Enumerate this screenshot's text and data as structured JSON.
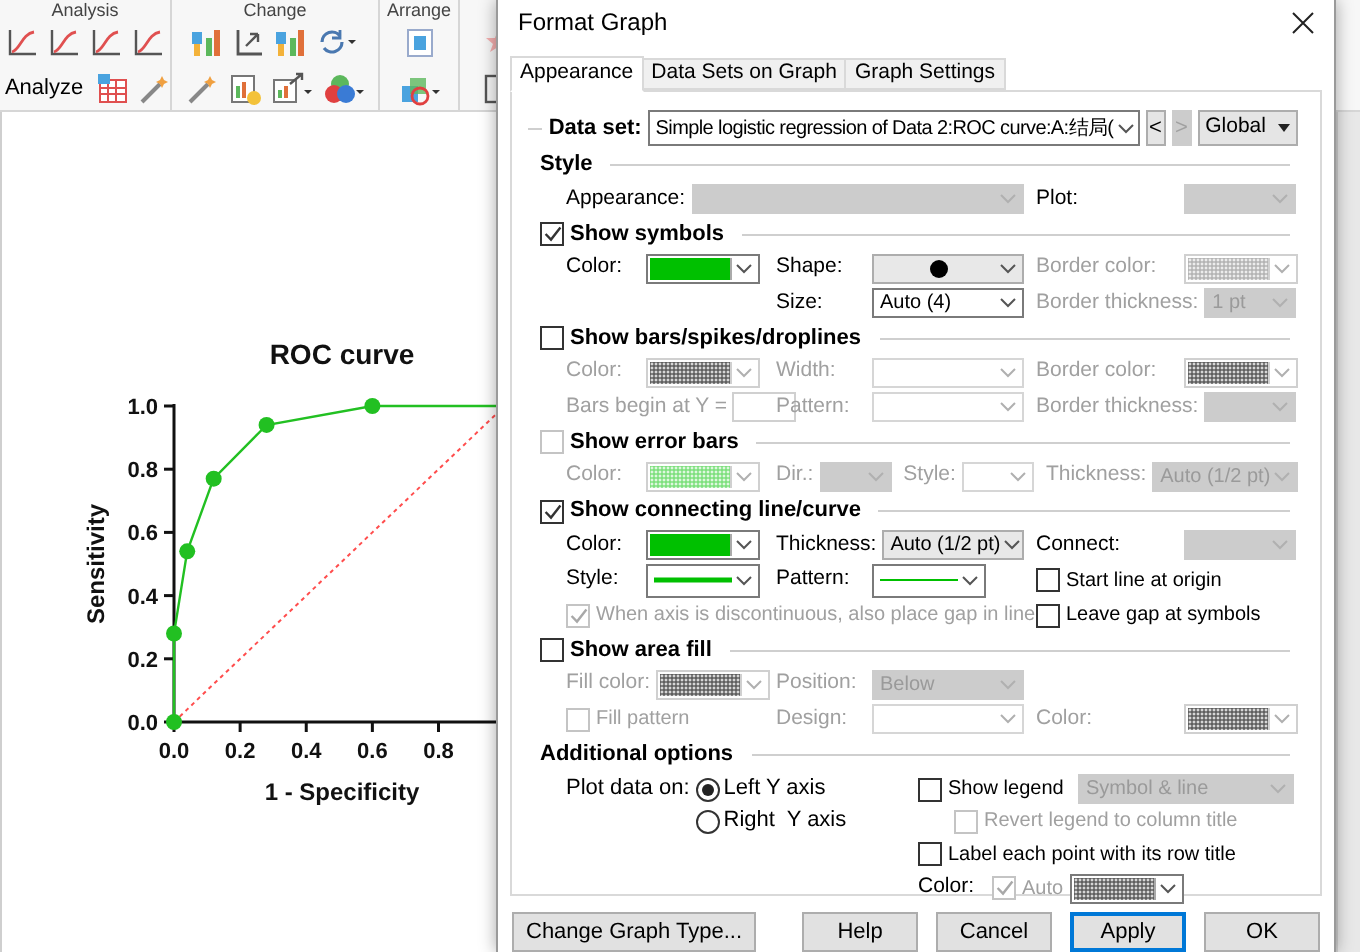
{
  "app": {
    "ribbon_groups": [
      "Analysis",
      "Change",
      "Arrange"
    ],
    "analyze_button": "Analyze"
  },
  "graph": {
    "chart_data": {
      "type": "line",
      "title": "ROC curve",
      "xlabel": "1 - Specificity",
      "ylabel": "Sensitivity",
      "x": [
        0,
        0,
        0.04,
        0.12,
        0.28,
        0.6,
        0.98
      ],
      "series": [
        {
          "color": "#22c022",
          "marker": "circle",
          "line_style": "solid",
          "values": [
            0,
            0.28,
            0.54,
            0.77,
            0.94,
            1,
            1
          ]
        },
        {
          "color": "#ff4d4d",
          "line_style": "dotted",
          "values": [
            0,
            0,
            0.04,
            0.12,
            0.28,
            0.6,
            0.98
          ]
        }
      ],
      "xlim": [
        0,
        0.98
      ],
      "ylim": [
        0,
        1
      ],
      "xticks": [
        {
          "value": 0,
          "label": "0.0"
        },
        {
          "value": 0.2,
          "label": "0.2"
        },
        {
          "value": 0.4,
          "label": "0.4"
        },
        {
          "value": 0.6,
          "label": "0.6"
        },
        {
          "value": 0.8,
          "label": "0.8"
        }
      ],
      "yticks": [
        {
          "value": 0,
          "label": "0.0"
        },
        {
          "value": 0.2,
          "label": "0.2"
        },
        {
          "value": 0.4,
          "label": "0.4"
        },
        {
          "value": 0.6,
          "label": "0.6"
        },
        {
          "value": 0.8,
          "label": "0.8"
        },
        {
          "value": 1,
          "label": "1.0"
        }
      ]
    }
  },
  "dialog": {
    "title": "Format Graph",
    "tabs": [
      {
        "label": "Appearance",
        "selected": true
      },
      {
        "label": "Data Sets on Graph",
        "selected": false
      },
      {
        "label": "Graph Settings",
        "selected": false
      }
    ],
    "data_set": {
      "label": "Data set:",
      "value": "Simple logistic regression of Data 2:ROC curve:A:结局(",
      "prev": "<",
      "next": ">",
      "next_disabled": true,
      "scope": "Global"
    },
    "sections": [
      {
        "kind": "form",
        "title": "Style",
        "rows": [
          {
            "kind": "grid",
            "left": {
              "kind": "field",
              "label": "Appearance:",
              "disabled": false,
              "controls": [
                {
                  "kind": "dropdown",
                  "disabled": true
                }
              ]
            },
            "right": {
              "kind": "field",
              "label": "Plot:",
              "disabled": false,
              "controls": [
                {
                  "kind": "dropdown",
                  "disabled": true
                }
              ]
            }
          }
        ]
      },
      {
        "kind": "form",
        "title": "Show symbols",
        "checked": true,
        "disabled": false,
        "rows": [
          {
            "kind": "grid",
            "left": {
              "kind": "field",
              "label": "Color:",
              "disabled": false,
              "controls": [
                {
                  "kind": "swatch",
                  "color": "#00c000",
                  "hatched": false,
                  "disabled": false
                }
              ]
            },
            "middle": {
              "kind": "field",
              "label": "Shape:",
              "disabled": false,
              "controls": [
                {
                  "kind": "shape",
                  "disabled": false
                }
              ]
            },
            "right": {
              "kind": "field",
              "label": "Border color:",
              "disabled": true,
              "controls": [
                {
                  "kind": "swatch",
                  "color": "#b4b4b4",
                  "hatched": true,
                  "disabled": true
                }
              ]
            }
          },
          {
            "kind": "grid",
            "middle": {
              "kind": "field",
              "label": "Size:",
              "disabled": false,
              "controls": [
                {
                  "kind": "combo",
                  "value": "Auto (4)",
                  "disabled": false
                }
              ]
            },
            "right": {
              "kind": "field",
              "label": "Border thickness:",
              "disabled": true,
              "controls": [
                {
                  "kind": "dropdown",
                  "value": "1 pt",
                  "disabled": true
                }
              ]
            }
          }
        ]
      },
      {
        "kind": "form",
        "title": "Show bars/spikes/droplines",
        "checked": false,
        "disabled": false,
        "rows": [
          {
            "kind": "grid",
            "left": {
              "kind": "field",
              "label": "Color:",
              "disabled": true,
              "controls": [
                {
                  "kind": "swatch",
                  "color": "#606060",
                  "hatched": true,
                  "disabled": true
                }
              ]
            },
            "middle": {
              "kind": "field",
              "label": "Width:",
              "disabled": true,
              "controls": [
                {
                  "kind": "combo",
                  "disabled": true
                }
              ]
            },
            "right": {
              "kind": "field",
              "label": "Border color:",
              "disabled": true,
              "controls": [
                {
                  "kind": "swatch",
                  "color": "#606060",
                  "hatched": true,
                  "disabled": true
                }
              ]
            }
          },
          {
            "kind": "grid",
            "left": {
              "kind": "field",
              "label": "Bars begin at Y =",
              "disabled": true,
              "controls": [
                {
                  "kind": "input",
                  "disabled": true
                }
              ]
            },
            "middle": {
              "kind": "field",
              "label": "Pattern:",
              "disabled": true,
              "controls": [
                {
                  "kind": "combo",
                  "disabled": true
                }
              ]
            },
            "right": {
              "kind": "field",
              "label": "Border thickness:",
              "disabled": true,
              "controls": [
                {
                  "kind": "dropdown",
                  "disabled": true
                }
              ]
            }
          }
        ]
      },
      {
        "kind": "form",
        "title": "Show error bars",
        "checked": false,
        "disabled": true,
        "rows": [
          {
            "kind": "flow",
            "items": [
              {
                "kind": "field",
                "label": "Color:",
                "disabled": true,
                "controls": [
                  {
                    "kind": "swatch",
                    "color": "#7ee07e",
                    "hatched": true,
                    "disabled": true
                  }
                ]
              },
              {
                "kind": "field",
                "label": "Dir.:",
                "disabled": true,
                "controls": [
                  {
                    "kind": "dropdown",
                    "disabled": true
                  }
                ]
              },
              {
                "kind": "field",
                "label": "Style:",
                "disabled": true,
                "controls": [
                  {
                    "kind": "combo",
                    "disabled": true
                  }
                ]
              },
              {
                "kind": "field",
                "label": "Thickness:",
                "disabled": true,
                "controls": [
                  {
                    "kind": "dropdown",
                    "value": "Auto (1/2 pt)",
                    "disabled": true
                  }
                ]
              }
            ]
          }
        ]
      },
      {
        "kind": "form",
        "title": "Show connecting line/curve",
        "checked": true,
        "disabled": false,
        "rows": [
          {
            "kind": "grid",
            "left": {
              "kind": "field",
              "label": "Color:",
              "disabled": false,
              "controls": [
                {
                  "kind": "swatch",
                  "color": "#00c000",
                  "hatched": false,
                  "disabled": false
                }
              ]
            },
            "middle": {
              "kind": "field",
              "label": "Thickness:",
              "disabled": false,
              "controls": [
                {
                  "kind": "dropdown",
                  "value": "Auto (1/2 pt)",
                  "disabled": false
                }
              ]
            },
            "right": {
              "kind": "field",
              "label": "Connect:",
              "disabled": false,
              "controls": [
                {
                  "kind": "dropdown",
                  "disabled": true
                }
              ]
            }
          },
          {
            "kind": "grid",
            "left": {
              "kind": "field",
              "label": "Style:",
              "disabled": false,
              "controls": [
                {
                  "kind": "line",
                  "color": "#00c000",
                  "thick": true
                }
              ]
            },
            "middle": {
              "kind": "field",
              "label": "Pattern:",
              "disabled": false,
              "controls": [
                {
                  "kind": "line",
                  "color": "#00c000",
                  "thick": false
                }
              ]
            },
            "right": {
              "kind": "check",
              "label": "Start line at origin",
              "checked": false,
              "disabled": false
            }
          },
          {
            "kind": "grid",
            "left": {
              "kind": "check",
              "label": "When axis is discontinuous, also place gap in line",
              "checked": true,
              "disabled": true
            },
            "right": {
              "kind": "check",
              "label": "Leave gap at symbols",
              "checked": false,
              "disabled": false
            }
          }
        ]
      },
      {
        "kind": "form",
        "title": "Show area fill",
        "checked": false,
        "disabled": false,
        "rows": [
          {
            "kind": "grid",
            "left": {
              "kind": "field",
              "label": "Fill color:",
              "disabled": true,
              "controls": [
                {
                  "kind": "swatch",
                  "color": "#606060",
                  "hatched": true,
                  "disabled": true
                }
              ]
            },
            "middle": {
              "kind": "field",
              "label": "Position:",
              "disabled": true,
              "controls": [
                {
                  "kind": "dropdown",
                  "value": "Below",
                  "disabled": true
                }
              ]
            }
          },
          {
            "kind": "grid",
            "left": {
              "kind": "check",
              "label": "Fill pattern",
              "checked": false,
              "disabled": true
            },
            "middle": {
              "kind": "field",
              "label": "Design:",
              "disabled": true,
              "controls": [
                {
                  "kind": "combo",
                  "disabled": true
                }
              ]
            },
            "right": {
              "kind": "field",
              "label": "Color:",
              "disabled": true,
              "controls": [
                {
                  "kind": "swatch",
                  "color": "#606060",
                  "hatched": true,
                  "disabled": true
                }
              ]
            }
          }
        ]
      },
      {
        "kind": "options",
        "title": "Additional options",
        "left": {
          "kind": "radio_group",
          "label": "Plot data on:",
          "options": [
            {
              "label": "Left Y axis",
              "selected": true
            },
            {
              "label": "Right  Y axis",
              "selected": false
            }
          ]
        },
        "right": [
          {
            "kind": "check",
            "label": "Show legend",
            "checked": false,
            "disabled": false,
            "controls": [
              {
                "kind": "dropdown",
                "value": "Symbol & line",
                "disabled": true
              }
            ],
            "children": [
              {
                "kind": "check",
                "label": "Revert legend to column title",
                "checked": false,
                "disabled": true
              }
            ]
          },
          {
            "kind": "check",
            "label": "Label each point with its row title",
            "checked": false,
            "disabled": false
          },
          {
            "kind": "field",
            "label": "Color:",
            "disabled": false,
            "controls": [
              {
                "kind": "check",
                "label": "Auto",
                "checked": true,
                "disabled": true
              },
              {
                "kind": "swatch",
                "color": "#606060",
                "hatched": true,
                "disabled": false
              }
            ]
          }
        ]
      }
    ],
    "buttons": [
      {
        "label": "Change Graph Type...",
        "kind": "side"
      },
      {
        "label": "Help",
        "kind": "normal"
      },
      {
        "label": "Cancel",
        "kind": "normal"
      },
      {
        "label": "Apply",
        "kind": "default"
      },
      {
        "label": "OK",
        "kind": "normal"
      }
    ]
  }
}
